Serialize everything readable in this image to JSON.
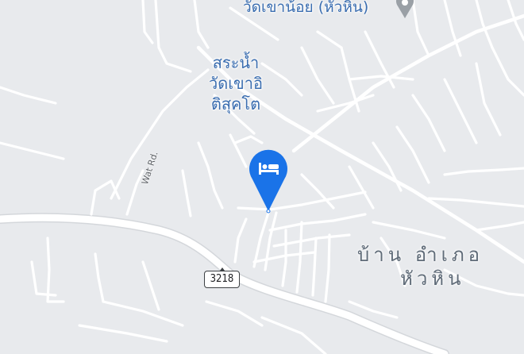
{
  "map": {
    "background_color": "#e8eaed",
    "road_color": "#ffffff",
    "poi_text_color": "#3a6db0",
    "area_text_color": "#5f6b78",
    "pin_color": "#1a73e8"
  },
  "labels": {
    "temple": "วัดเขาน้อย (หัวหิน)",
    "pond_line1": "สระน้ำ",
    "pond_line2": "วัดเขาอิ",
    "pond_line3": "ติสุคโต",
    "road_name": "Wat Rd.",
    "area_line1": "บ้าน อำเภอ",
    "area_line2": "หัวหิน",
    "route_number": "3218"
  },
  "markers": {
    "hotel": {
      "icon": "bed-icon"
    },
    "temple": {
      "icon": "map-pin-icon"
    }
  }
}
